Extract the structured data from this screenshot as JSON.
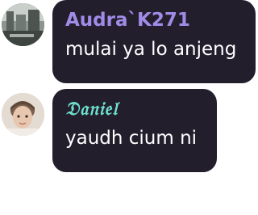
{
  "messages": [
    {
      "username": "Audra`K271",
      "text": "mulai ya lo anjeng",
      "name_color": "#a08ce8",
      "bubble_color": "#231e2c"
    },
    {
      "username": "𝔇𝔞𝔫𝔦𝔢𝔩",
      "text": "yaudh cium ni",
      "name_color": "#6fe0cf",
      "bubble_color": "#231e2c"
    }
  ],
  "avatars": [
    "avatar-landscape-photo",
    "avatar-person-photo"
  ]
}
